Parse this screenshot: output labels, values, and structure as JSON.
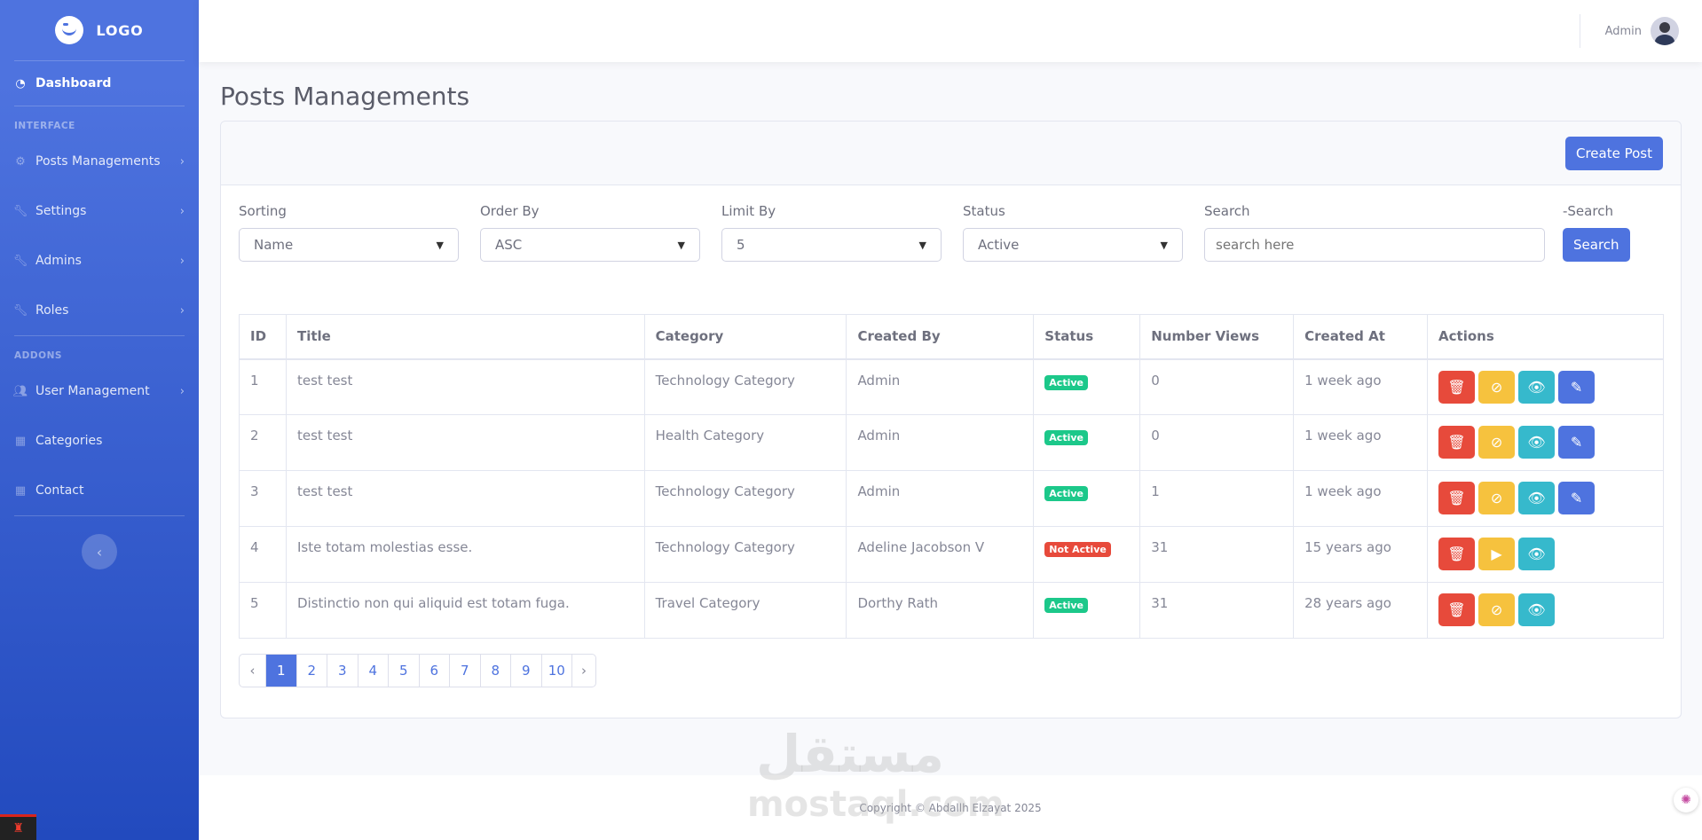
{
  "brand": {
    "logo_text": "LOGO"
  },
  "sidebar": {
    "dashboard": "Dashboard",
    "heading_interface": "INTERFACE",
    "heading_addons": "ADDONS",
    "items": [
      {
        "label": "Posts Managements",
        "icon": "gear-icon",
        "chevron": "›"
      },
      {
        "label": "Settings",
        "icon": "wrench-icon",
        "chevron": "›"
      },
      {
        "label": "Admins",
        "icon": "wrench-icon",
        "chevron": "›"
      },
      {
        "label": "Roles",
        "icon": "wrench-icon",
        "chevron": "›"
      }
    ],
    "addon_items": [
      {
        "label": "User Management",
        "icon": "users-icon",
        "chevron": "›"
      },
      {
        "label": "Categories",
        "icon": "boxes-icon"
      },
      {
        "label": "Contact",
        "icon": "boxes-icon"
      }
    ],
    "toggle_glyph": "‹"
  },
  "topbar": {
    "user_name": "Admin"
  },
  "page": {
    "title": "Posts Managements"
  },
  "card": {
    "create_button": "Create Post"
  },
  "filters": {
    "sorting": {
      "label": "Sorting",
      "value": "Name"
    },
    "order_by": {
      "label": "Order By",
      "value": "ASC"
    },
    "limit_by": {
      "label": "Limit By",
      "value": "5"
    },
    "status": {
      "label": "Status",
      "value": "Active"
    },
    "search": {
      "label": "Search",
      "placeholder": "search here"
    },
    "search_button": {
      "label": "-Search",
      "button": "Search"
    }
  },
  "table": {
    "headers": [
      "ID",
      "Title",
      "Category",
      "Created By",
      "Status",
      "Number Views",
      "Created At",
      "Actions"
    ],
    "rows": [
      {
        "id": "1",
        "title": "test test",
        "category": "Technology Category",
        "created_by": "Admin",
        "status": "Active",
        "views": "0",
        "created_at": "1 week ago"
      },
      {
        "id": "2",
        "title": "test test",
        "category": "Health Category",
        "created_by": "Admin",
        "status": "Active",
        "views": "0",
        "created_at": "1 week ago"
      },
      {
        "id": "3",
        "title": "test test",
        "category": "Technology Category",
        "created_by": "Admin",
        "status": "Active",
        "views": "1",
        "created_at": "1 week ago"
      },
      {
        "id": "4",
        "title": "Iste totam molestias esse.",
        "category": "Technology Category",
        "created_by": "Adeline Jacobson V",
        "status": "Not Active",
        "views": "31",
        "created_at": "15 years ago"
      },
      {
        "id": "5",
        "title": "Distinctio non qui aliquid est totam fuga.",
        "category": "Travel Category",
        "created_by": "Dorthy Rath",
        "status": "Active",
        "views": "31",
        "created_at": "28 years ago"
      }
    ]
  },
  "pagination": {
    "prev": "‹",
    "pages": [
      "1",
      "2",
      "3",
      "4",
      "5",
      "6",
      "7",
      "8",
      "9",
      "10"
    ],
    "next": "›",
    "current": "1"
  },
  "footer": {
    "copyright": "Copyright © Abdallh Elzayat 2025"
  },
  "watermark": {
    "arabic": "مستقل",
    "latin": "mostaql.com"
  },
  "colors": {
    "primary": "#4e73df",
    "danger": "#e74a3b",
    "warning": "#f6c23e",
    "info": "#36b9cc",
    "success": "#1cc88a"
  }
}
